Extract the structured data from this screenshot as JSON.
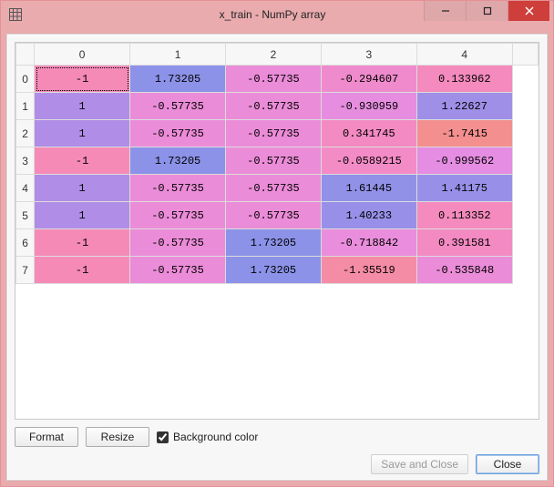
{
  "window": {
    "title": "x_train - NumPy array"
  },
  "chart_data": {
    "type": "table",
    "title": "x_train - NumPy array",
    "columns": [
      "0",
      "1",
      "2",
      "3",
      "4"
    ],
    "rows": [
      "0",
      "1",
      "2",
      "3",
      "4",
      "5",
      "6",
      "7"
    ],
    "values": [
      [
        -1,
        1.73205,
        -0.57735,
        -0.294607,
        0.133962
      ],
      [
        1,
        -0.57735,
        -0.57735,
        -0.930959,
        1.22627
      ],
      [
        1,
        -0.57735,
        -0.57735,
        0.341745,
        -1.7415
      ],
      [
        -1,
        1.73205,
        -0.57735,
        -0.0589215,
        -0.999562
      ],
      [
        1,
        -0.57735,
        -0.57735,
        1.61445,
        1.41175
      ],
      [
        1,
        -0.57735,
        -0.57735,
        1.40233,
        0.113352
      ],
      [
        -1,
        -0.57735,
        1.73205,
        -0.718842,
        0.391581
      ],
      [
        -1,
        -0.57735,
        1.73205,
        -1.35519,
        -0.535848
      ]
    ]
  },
  "grid": {
    "col_headers": [
      "0",
      "1",
      "2",
      "3",
      "4"
    ],
    "row_headers": [
      "0",
      "1",
      "2",
      "3",
      "4",
      "5",
      "6",
      "7"
    ],
    "cells": [
      [
        {
          "t": "-1",
          "c": "#f58ab7"
        },
        {
          "t": "1.73205",
          "c": "#8c92e8"
        },
        {
          "t": "-0.57735",
          "c": "#eb8cd8"
        },
        {
          "t": "-0.294607",
          "c": "#ef8bcc"
        },
        {
          "t": "0.133962",
          "c": "#f48abd"
        }
      ],
      [
        {
          "t": "1",
          "c": "#b08de6"
        },
        {
          "t": "-0.57735",
          "c": "#eb8cd8"
        },
        {
          "t": "-0.57735",
          "c": "#eb8cd8"
        },
        {
          "t": "-0.930959",
          "c": "#e68de0"
        },
        {
          "t": "1.22627",
          "c": "#9f8fe7"
        }
      ],
      [
        {
          "t": "1",
          "c": "#b08de6"
        },
        {
          "t": "-0.57735",
          "c": "#eb8cd8"
        },
        {
          "t": "-0.57735",
          "c": "#eb8cd8"
        },
        {
          "t": "0.341745",
          "c": "#f38ac2"
        },
        {
          "t": "-1.7415",
          "c": "#f48f8f"
        }
      ],
      [
        {
          "t": "-1",
          "c": "#f58ab7"
        },
        {
          "t": "1.73205",
          "c": "#8c92e8"
        },
        {
          "t": "-0.57735",
          "c": "#eb8cd8"
        },
        {
          "t": "-0.0589215",
          "c": "#f38bc6"
        },
        {
          "t": "-0.999562",
          "c": "#e48de2"
        }
      ],
      [
        {
          "t": "1",
          "c": "#b08de6"
        },
        {
          "t": "-0.57735",
          "c": "#eb8cd8"
        },
        {
          "t": "-0.57735",
          "c": "#eb8cd8"
        },
        {
          "t": "1.61445",
          "c": "#9191e8"
        },
        {
          "t": "1.41175",
          "c": "#9890e8"
        }
      ],
      [
        {
          "t": "1",
          "c": "#b08de6"
        },
        {
          "t": "-0.57735",
          "c": "#eb8cd8"
        },
        {
          "t": "-0.57735",
          "c": "#eb8cd8"
        },
        {
          "t": "1.40233",
          "c": "#9890e8"
        },
        {
          "t": "0.113352",
          "c": "#f48abd"
        }
      ],
      [
        {
          "t": "-1",
          "c": "#f58ab7"
        },
        {
          "t": "-0.57735",
          "c": "#eb8cd8"
        },
        {
          "t": "1.73205",
          "c": "#8c92e8"
        },
        {
          "t": "-0.718842",
          "c": "#e98ddc"
        },
        {
          "t": "0.391581",
          "c": "#f38ac2"
        }
      ],
      [
        {
          "t": "-1",
          "c": "#f58ab7"
        },
        {
          "t": "-0.57735",
          "c": "#eb8cd8"
        },
        {
          "t": "1.73205",
          "c": "#8c92e8"
        },
        {
          "t": "-1.35519",
          "c": "#f58ca5"
        },
        {
          "t": "-0.535848",
          "c": "#eb8cd8"
        }
      ]
    ]
  },
  "toolbar": {
    "format_label": "Format",
    "resize_label": "Resize",
    "bgcolor_label": "Background color",
    "bgcolor_checked": true
  },
  "footer": {
    "save_close_label": "Save and Close",
    "close_label": "Close"
  }
}
